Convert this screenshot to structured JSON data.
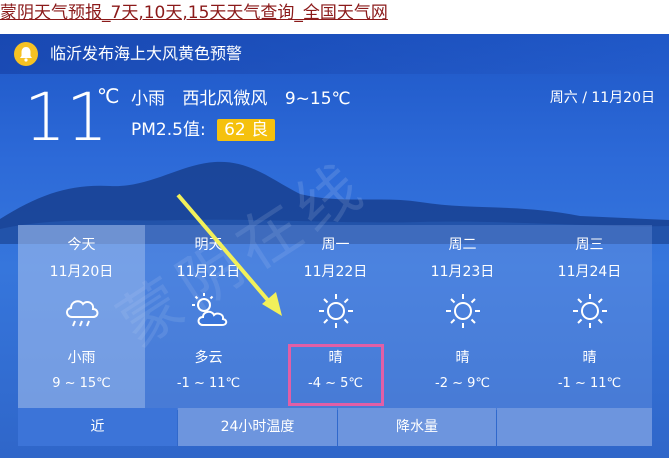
{
  "title_link": "蒙阴天气预报_7天,10天,15天天气查询_全国天气网",
  "alert": {
    "text": "临沂发布海上大风黄色预警"
  },
  "current": {
    "temperature": "11",
    "unit": "℃",
    "condition": "小雨",
    "wind": "西北风微风",
    "range": "9~15℃",
    "pm25_label": "PM2.5值:",
    "aqi_value": "62 良",
    "date": "周六 / 11月20日"
  },
  "forecast": [
    {
      "day": "今天",
      "date": "11月20日",
      "icon": "rain-cloud-icon",
      "cond": "小雨",
      "range": "9 ~ 15℃"
    },
    {
      "day": "明天",
      "date": "11月21日",
      "icon": "partly-cloudy-icon",
      "cond": "多云",
      "range": "-1 ~ 11℃"
    },
    {
      "day": "周一",
      "date": "11月22日",
      "icon": "sun-icon",
      "cond": "晴",
      "range": "-4 ~ 5℃"
    },
    {
      "day": "周二",
      "date": "11月23日",
      "icon": "sun-icon",
      "cond": "晴",
      "range": "-2 ~ 9℃"
    },
    {
      "day": "周三",
      "date": "11月24日",
      "icon": "sun-icon",
      "cond": "晴",
      "range": "-1 ~ 11℃"
    }
  ],
  "tabs": [
    "近",
    "24小时温度",
    "降水量",
    ""
  ],
  "watermark": "蒙阴在线",
  "colors": {
    "aqi_badge": "#f5c10e",
    "alert_icon": "#f6c223",
    "highlight_box": "#e15fa6",
    "arrow": "#f2f05a"
  }
}
